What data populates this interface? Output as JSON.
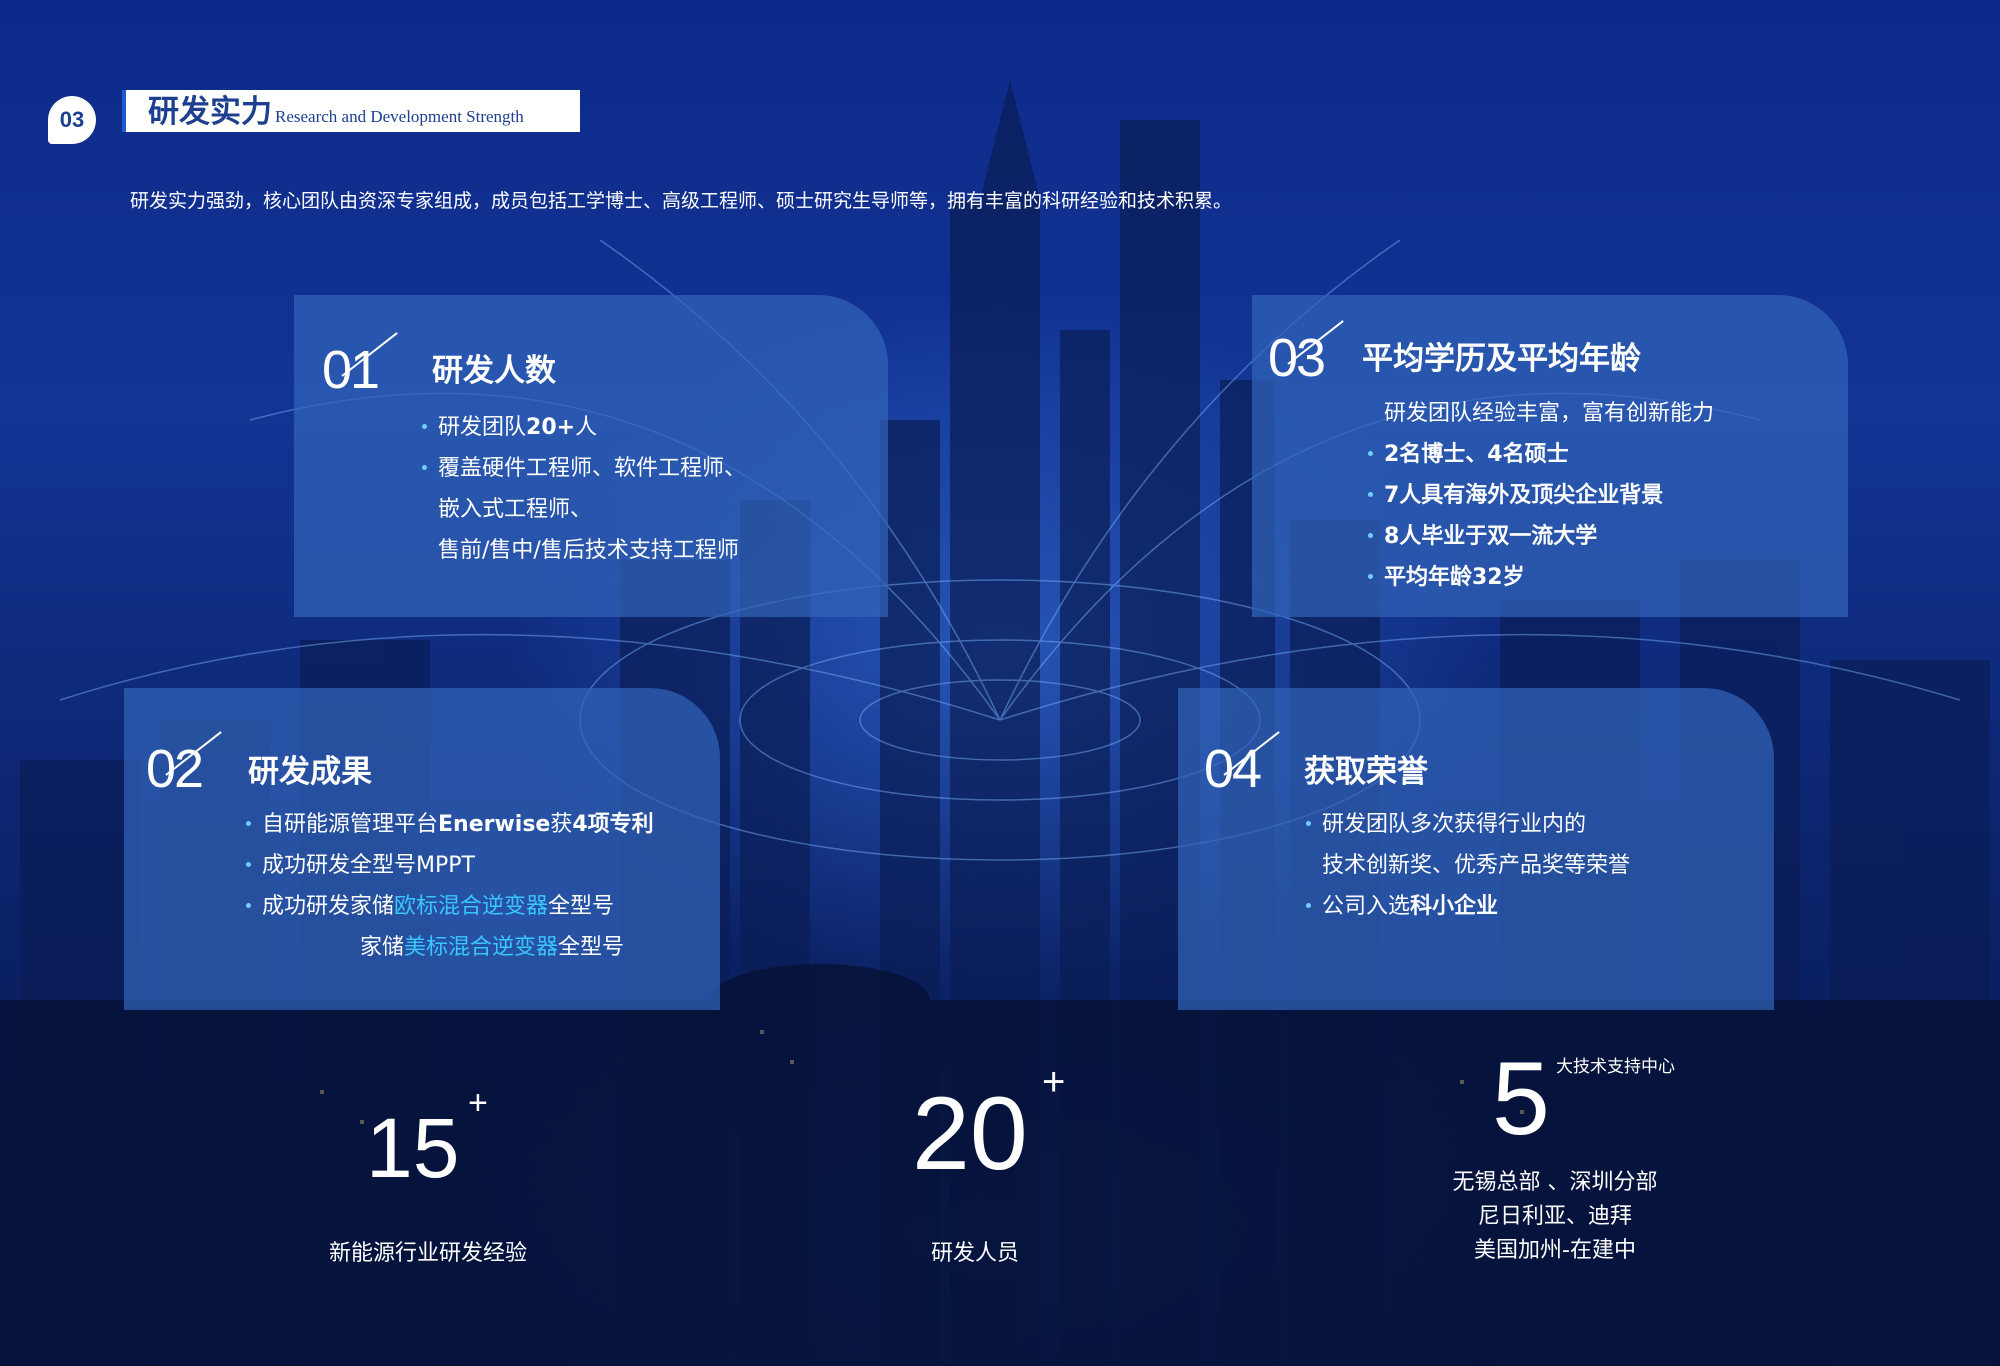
{
  "section": {
    "number": "03",
    "title_cn": "研发实力",
    "title_en": "Research and Development Strength",
    "intro": "研发实力强劲，核心团队由资深专家组成，成员包括工学博士、高级工程师、硕士研究生导师等，拥有丰富的科研经验和技术积累。"
  },
  "cards": {
    "c1": {
      "num": "01",
      "title": "研发人数",
      "lines": [
        "研发团队",
        "20+",
        "人",
        "覆盖硬件工程师、软件工程师、",
        "嵌入式工程师、",
        "售前/售中/售后技术支持工程师"
      ]
    },
    "c2": {
      "num": "02",
      "title": "研发成果",
      "lines": [
        "自研能源管理平台",
        "Enerwise",
        "获",
        "4项专利",
        "成功研发全型号MPPT",
        "成功研发家储",
        "欧标混合逆变器",
        "全型号",
        "家储",
        "美标混合逆变器",
        "全型号"
      ]
    },
    "c3": {
      "num": "03",
      "title": "平均学历及平均年龄",
      "lines": [
        "研发团队经验丰富，富有创新能力",
        "2名博士、4名硕士",
        "7人具有海外及顶尖企业背景",
        "8人毕业于双一流大学",
        "平均年龄32岁"
      ]
    },
    "c4": {
      "num": "04",
      "title": "获取荣誉",
      "lines": [
        "研发团队多次获得行业内的",
        "技术创新奖、优秀产品奖等荣誉",
        "公司入选",
        "科小企业"
      ]
    }
  },
  "stats": {
    "s1": {
      "value": "15",
      "plus": "+",
      "label": "新能源行业研发经验"
    },
    "s2": {
      "value": "20",
      "plus": "+",
      "label": "研发人员"
    },
    "s3": {
      "value": "5",
      "sup": "大技术支持中心",
      "line1": "无锡总部 、深圳分部",
      "line2": "尼日利亚、迪拜",
      "line3": "美国加州-在建中"
    }
  },
  "colors": {
    "card_bg": "#3264b9",
    "highlight": "#39c6ff",
    "bullet": "#6fd0ff",
    "title_blue": "#1d3f8f"
  }
}
